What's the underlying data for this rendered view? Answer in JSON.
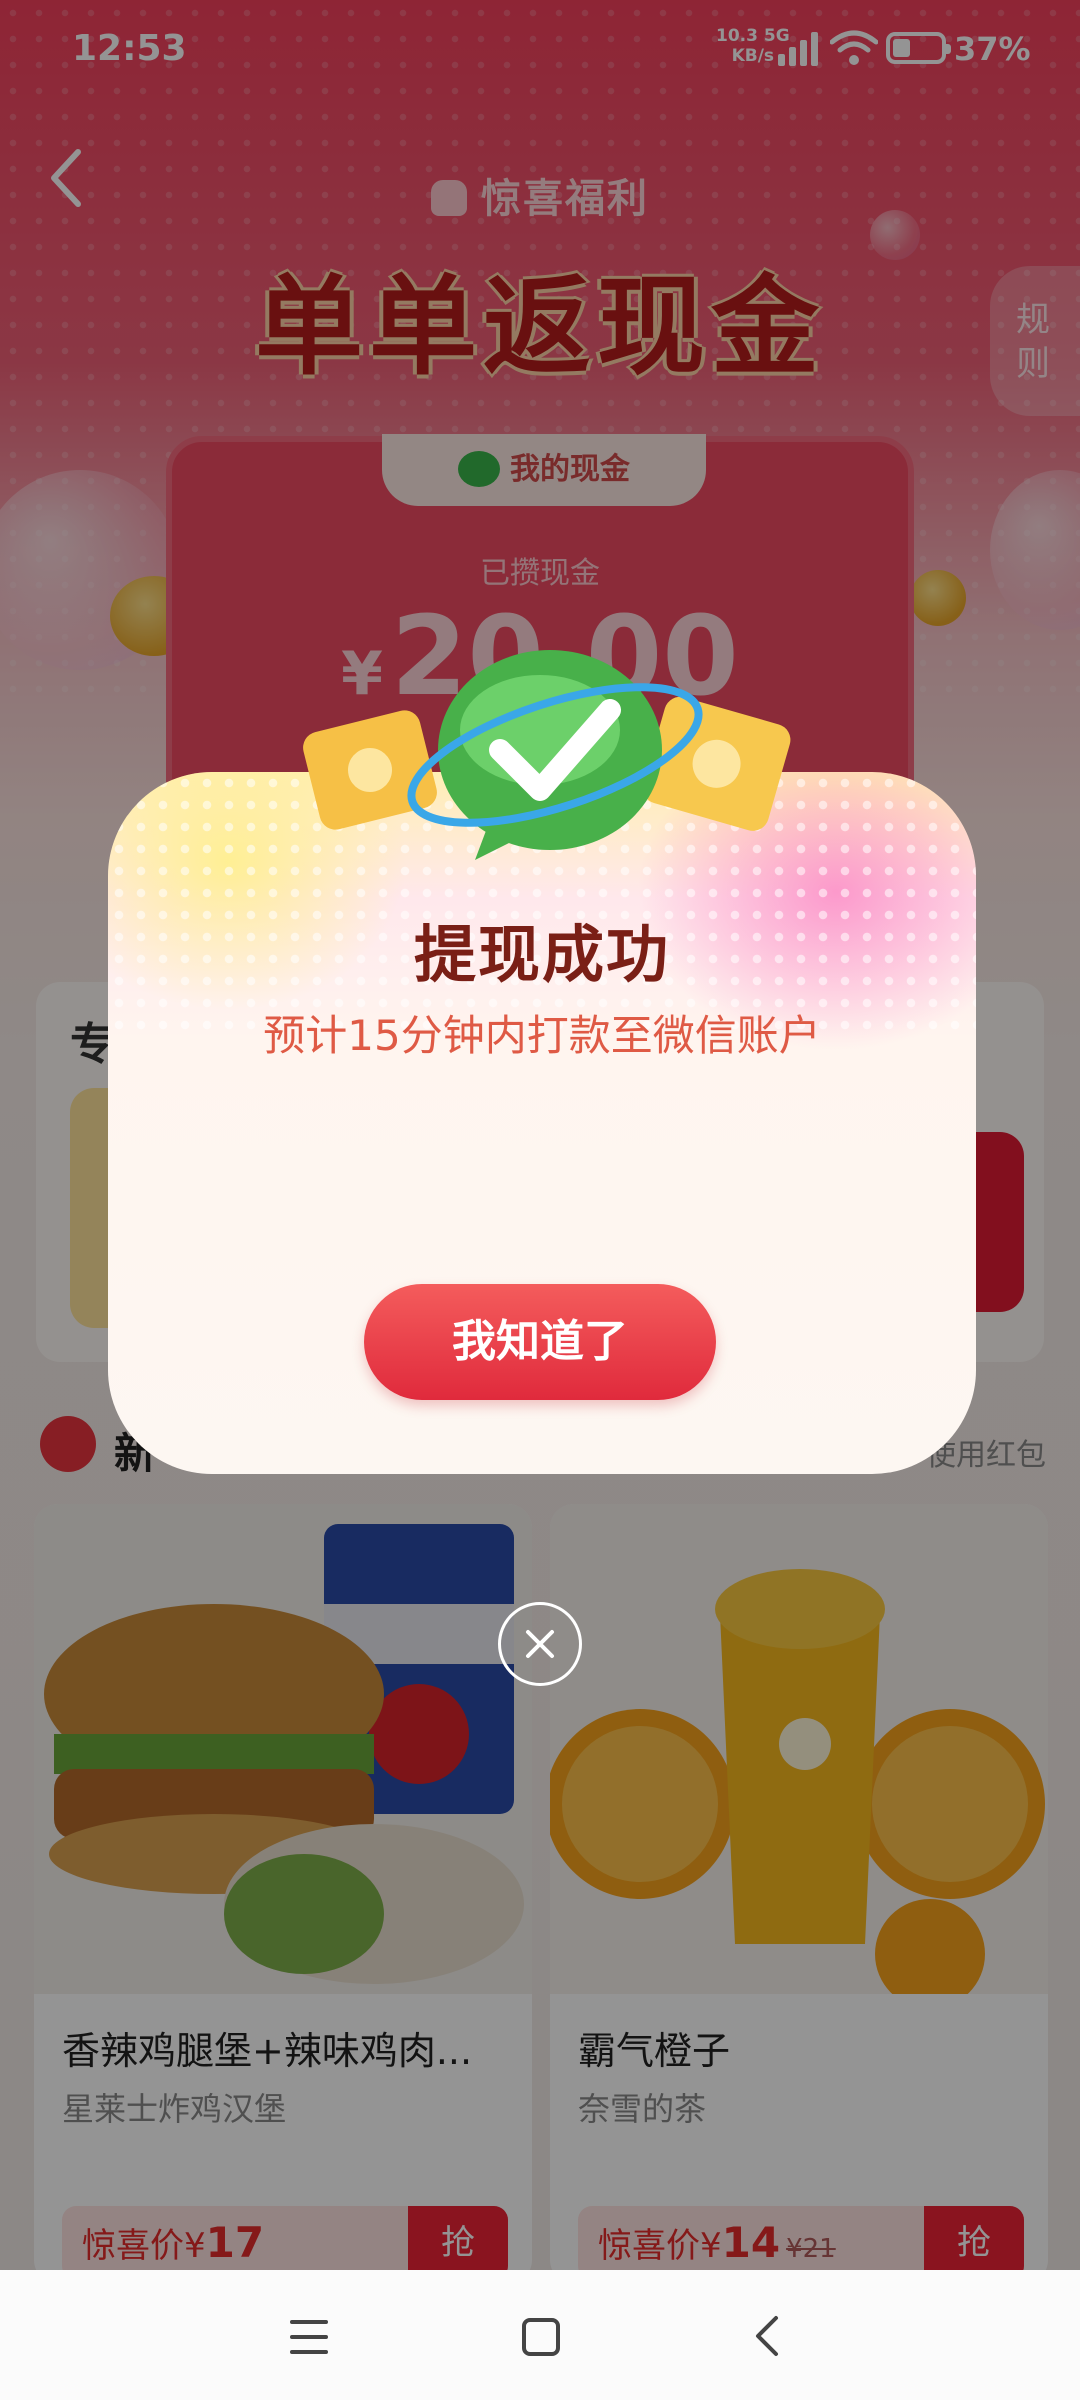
{
  "status_bar": {
    "time": "12:53",
    "network_speed": "10.3",
    "network_unit": "KB/s",
    "network_type": "5G",
    "battery": "37%"
  },
  "page": {
    "brand": "惊喜福利",
    "headline": "单单返现金",
    "rules_label": "规则",
    "cash_tab": "我的现金",
    "cash_label": "已攒现金",
    "cash_currency": "¥",
    "cash_amount": "20.00",
    "promo_partial_label": "专",
    "section_partial_label": "新",
    "section_right": "使用红包"
  },
  "products": [
    {
      "name": "香辣鸡腿堡+辣味鸡肉...",
      "shop": "星莱士炸鸡汉堡",
      "price_label": "惊喜价",
      "currency": "¥",
      "price": "17",
      "original_price": "",
      "grab": "抢"
    },
    {
      "name": "霸气橙子",
      "shop": "奈雪的茶",
      "price_label": "惊喜价",
      "currency": "¥",
      "price": "14",
      "original_price": "¥21",
      "grab": "抢"
    }
  ],
  "dialog": {
    "title": "提现成功",
    "subtitle": "预计15分钟内打款至微信账户",
    "button": "我知道了"
  },
  "colors": {
    "primary_red": "#e02a3c",
    "title_brown": "#7a1f16",
    "subtitle_orange": "#df5a45",
    "wechat_green": "#39b54a"
  }
}
